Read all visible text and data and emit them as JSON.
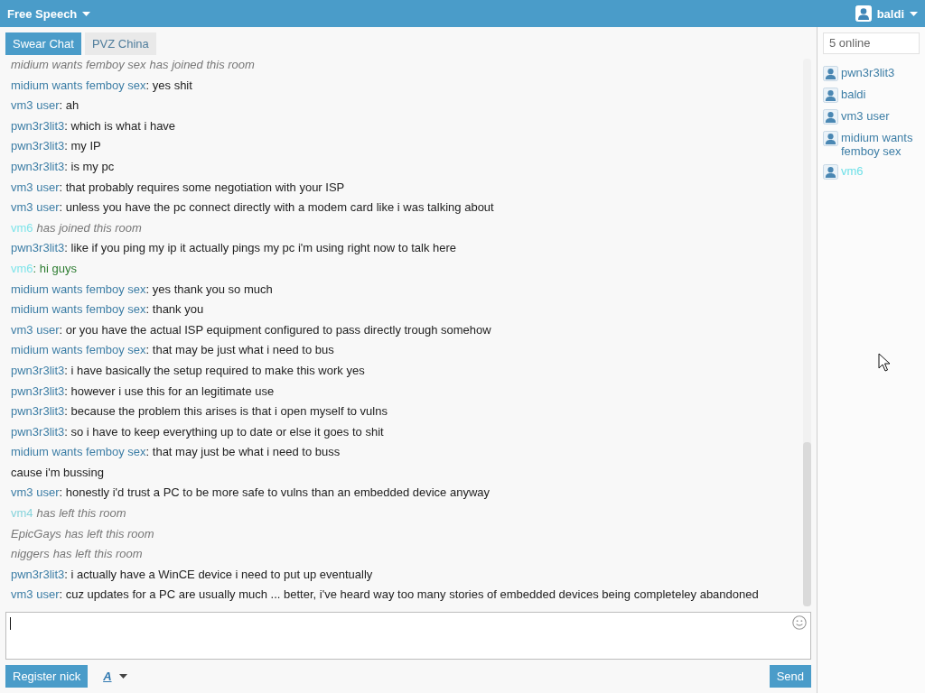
{
  "header": {
    "room": "Free Speech",
    "user": "baldi"
  },
  "tabs": [
    {
      "label": "Swear Chat",
      "selected": true
    },
    {
      "label": "PVZ China",
      "selected": false
    }
  ],
  "messages": [
    {
      "kind": "system",
      "name": "midium wants femboy sex",
      "text": "has joined this room"
    },
    {
      "kind": "message",
      "name": "midium wants femboy sex",
      "text": ": yes shit"
    },
    {
      "kind": "message",
      "name": "vm3 user",
      "text": ": ah"
    },
    {
      "kind": "message",
      "name": "pwn3r3lit3",
      "text": ": which is what i have"
    },
    {
      "kind": "message",
      "name": "pwn3r3lit3",
      "text": ": my IP"
    },
    {
      "kind": "message",
      "name": "pwn3r3lit3",
      "text": ": is my pc"
    },
    {
      "kind": "message",
      "name": "vm3 user",
      "text": ": that probably requires some negotiation with your ISP"
    },
    {
      "kind": "message",
      "name": "vm3 user",
      "text": ": unless you have the pc connect directly with a modem card like i was talking about"
    },
    {
      "kind": "system",
      "name": "vm6",
      "color": "#7fe4ea",
      "text": "has joined this room"
    },
    {
      "kind": "message",
      "name": "pwn3r3lit3",
      "text": ": like if you ping my ip it actually pings my pc i'm using right now to talk here"
    },
    {
      "kind": "message",
      "name": "vm6",
      "color": "#7fe4ea",
      "font": {
        "color": "#2e7d32"
      },
      "text": ": hi guys"
    },
    {
      "kind": "message",
      "name": "midium wants femboy sex",
      "text": ": yes thank you so much"
    },
    {
      "kind": "message",
      "name": "midium wants femboy sex",
      "text": ": thank you"
    },
    {
      "kind": "message",
      "name": "vm3 user",
      "text": ": or you have the actual ISP equipment configured to pass directly trough somehow"
    },
    {
      "kind": "message",
      "name": "midium wants femboy sex",
      "text": ": that may be just what i need to bus"
    },
    {
      "kind": "message",
      "name": "pwn3r3lit3",
      "text": ": i have basically the setup required to make this work yes"
    },
    {
      "kind": "message",
      "name": "pwn3r3lit3",
      "text": ": however i use this for an legitimate use"
    },
    {
      "kind": "message",
      "name": "pwn3r3lit3",
      "text": ": because the problem this arises is that i open myself to vulns"
    },
    {
      "kind": "message",
      "name": "pwn3r3lit3",
      "text": ": so i have to keep everything up to date or else it goes to shit"
    },
    {
      "kind": "message",
      "name": "midium wants femboy sex",
      "text": ": that may just be what i need to buss"
    },
    {
      "kind": "continuation",
      "text": "cause i'm bussing"
    },
    {
      "kind": "message",
      "name": "vm3 user",
      "text": ": honestly i'd trust a PC to be more safe to vulns than an embedded device anyway"
    },
    {
      "kind": "system",
      "name": "vm4",
      "color": "#86d3db",
      "text": "has left this room"
    },
    {
      "kind": "system",
      "name": "EpicGays",
      "text": "has left this room"
    },
    {
      "kind": "system",
      "name": "niggers",
      "text": "has left this room"
    },
    {
      "kind": "message",
      "name": "pwn3r3lit3",
      "text": ": i actually have a WinCE device i need to put up eventually"
    },
    {
      "kind": "message",
      "name": "vm3 user",
      "text": ": cuz updates for a PC are usually much ... better, i've heard way too many stories of embedded devices being completeley abandoned"
    }
  ],
  "composer": {
    "register_button": "Register nick",
    "font_button": "A",
    "send_button": "Send"
  },
  "sidebar": {
    "online_count": "5 online",
    "users": [
      {
        "name": "pwn3r3lit3",
        "color": "#3d7ea6"
      },
      {
        "name": "baldi",
        "color": "#3d7ea6"
      },
      {
        "name": "vm3 user",
        "color": "#3d7ea6"
      },
      {
        "name": "midium wants femboy sex",
        "color": "#3d7ea6"
      },
      {
        "name": "vm6",
        "color": "#6fe0e8"
      }
    ]
  }
}
